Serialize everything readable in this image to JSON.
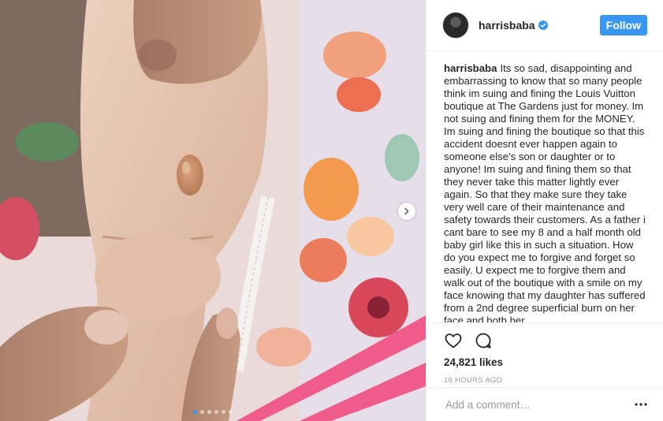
{
  "post": {
    "username": "harrisbaba",
    "verified": true,
    "follow_label": "Follow",
    "caption_user": "harrisbaba",
    "caption_text": "Its so sad, disappointing and embarrassing to know that so many people think im suing and fining the Louis Vuitton boutique at The Gardens just for money. Im not suing and fining them for the MONEY. Im suing and fining the boutique so that this accident doesnt ever happen again to someone else's son or daughter or to anyone! Im suing and fining them so that they never take this matter lightly ever again. So that they make sure they take very well care of their maintenance and safety towards their customers. As a father i cant bare to see my 8 and a half month old baby girl like this in such a situation. How do you expect me to forgive and forget so easily. U expect me to forgive them and walk out of the boutique with a smile on my face knowing that my daughter has suffered from a 2nd degree superficial burn on her face and both her",
    "likes": "24,821 likes",
    "timestamp": "16 HOURS AGO",
    "comment_placeholder": "Add a comment…"
  },
  "carousel": {
    "slide_count": 6,
    "active_index": 0
  },
  "icons": {
    "verified": "verified-badge-icon",
    "like": "heart-icon",
    "comment": "comment-bubble-icon",
    "next": "chevron-right-icon",
    "more": "more-horizontal-icon"
  },
  "colors": {
    "accent": "#3897f0",
    "text": "#262626",
    "muted": "#999999",
    "border": "#efefef"
  }
}
